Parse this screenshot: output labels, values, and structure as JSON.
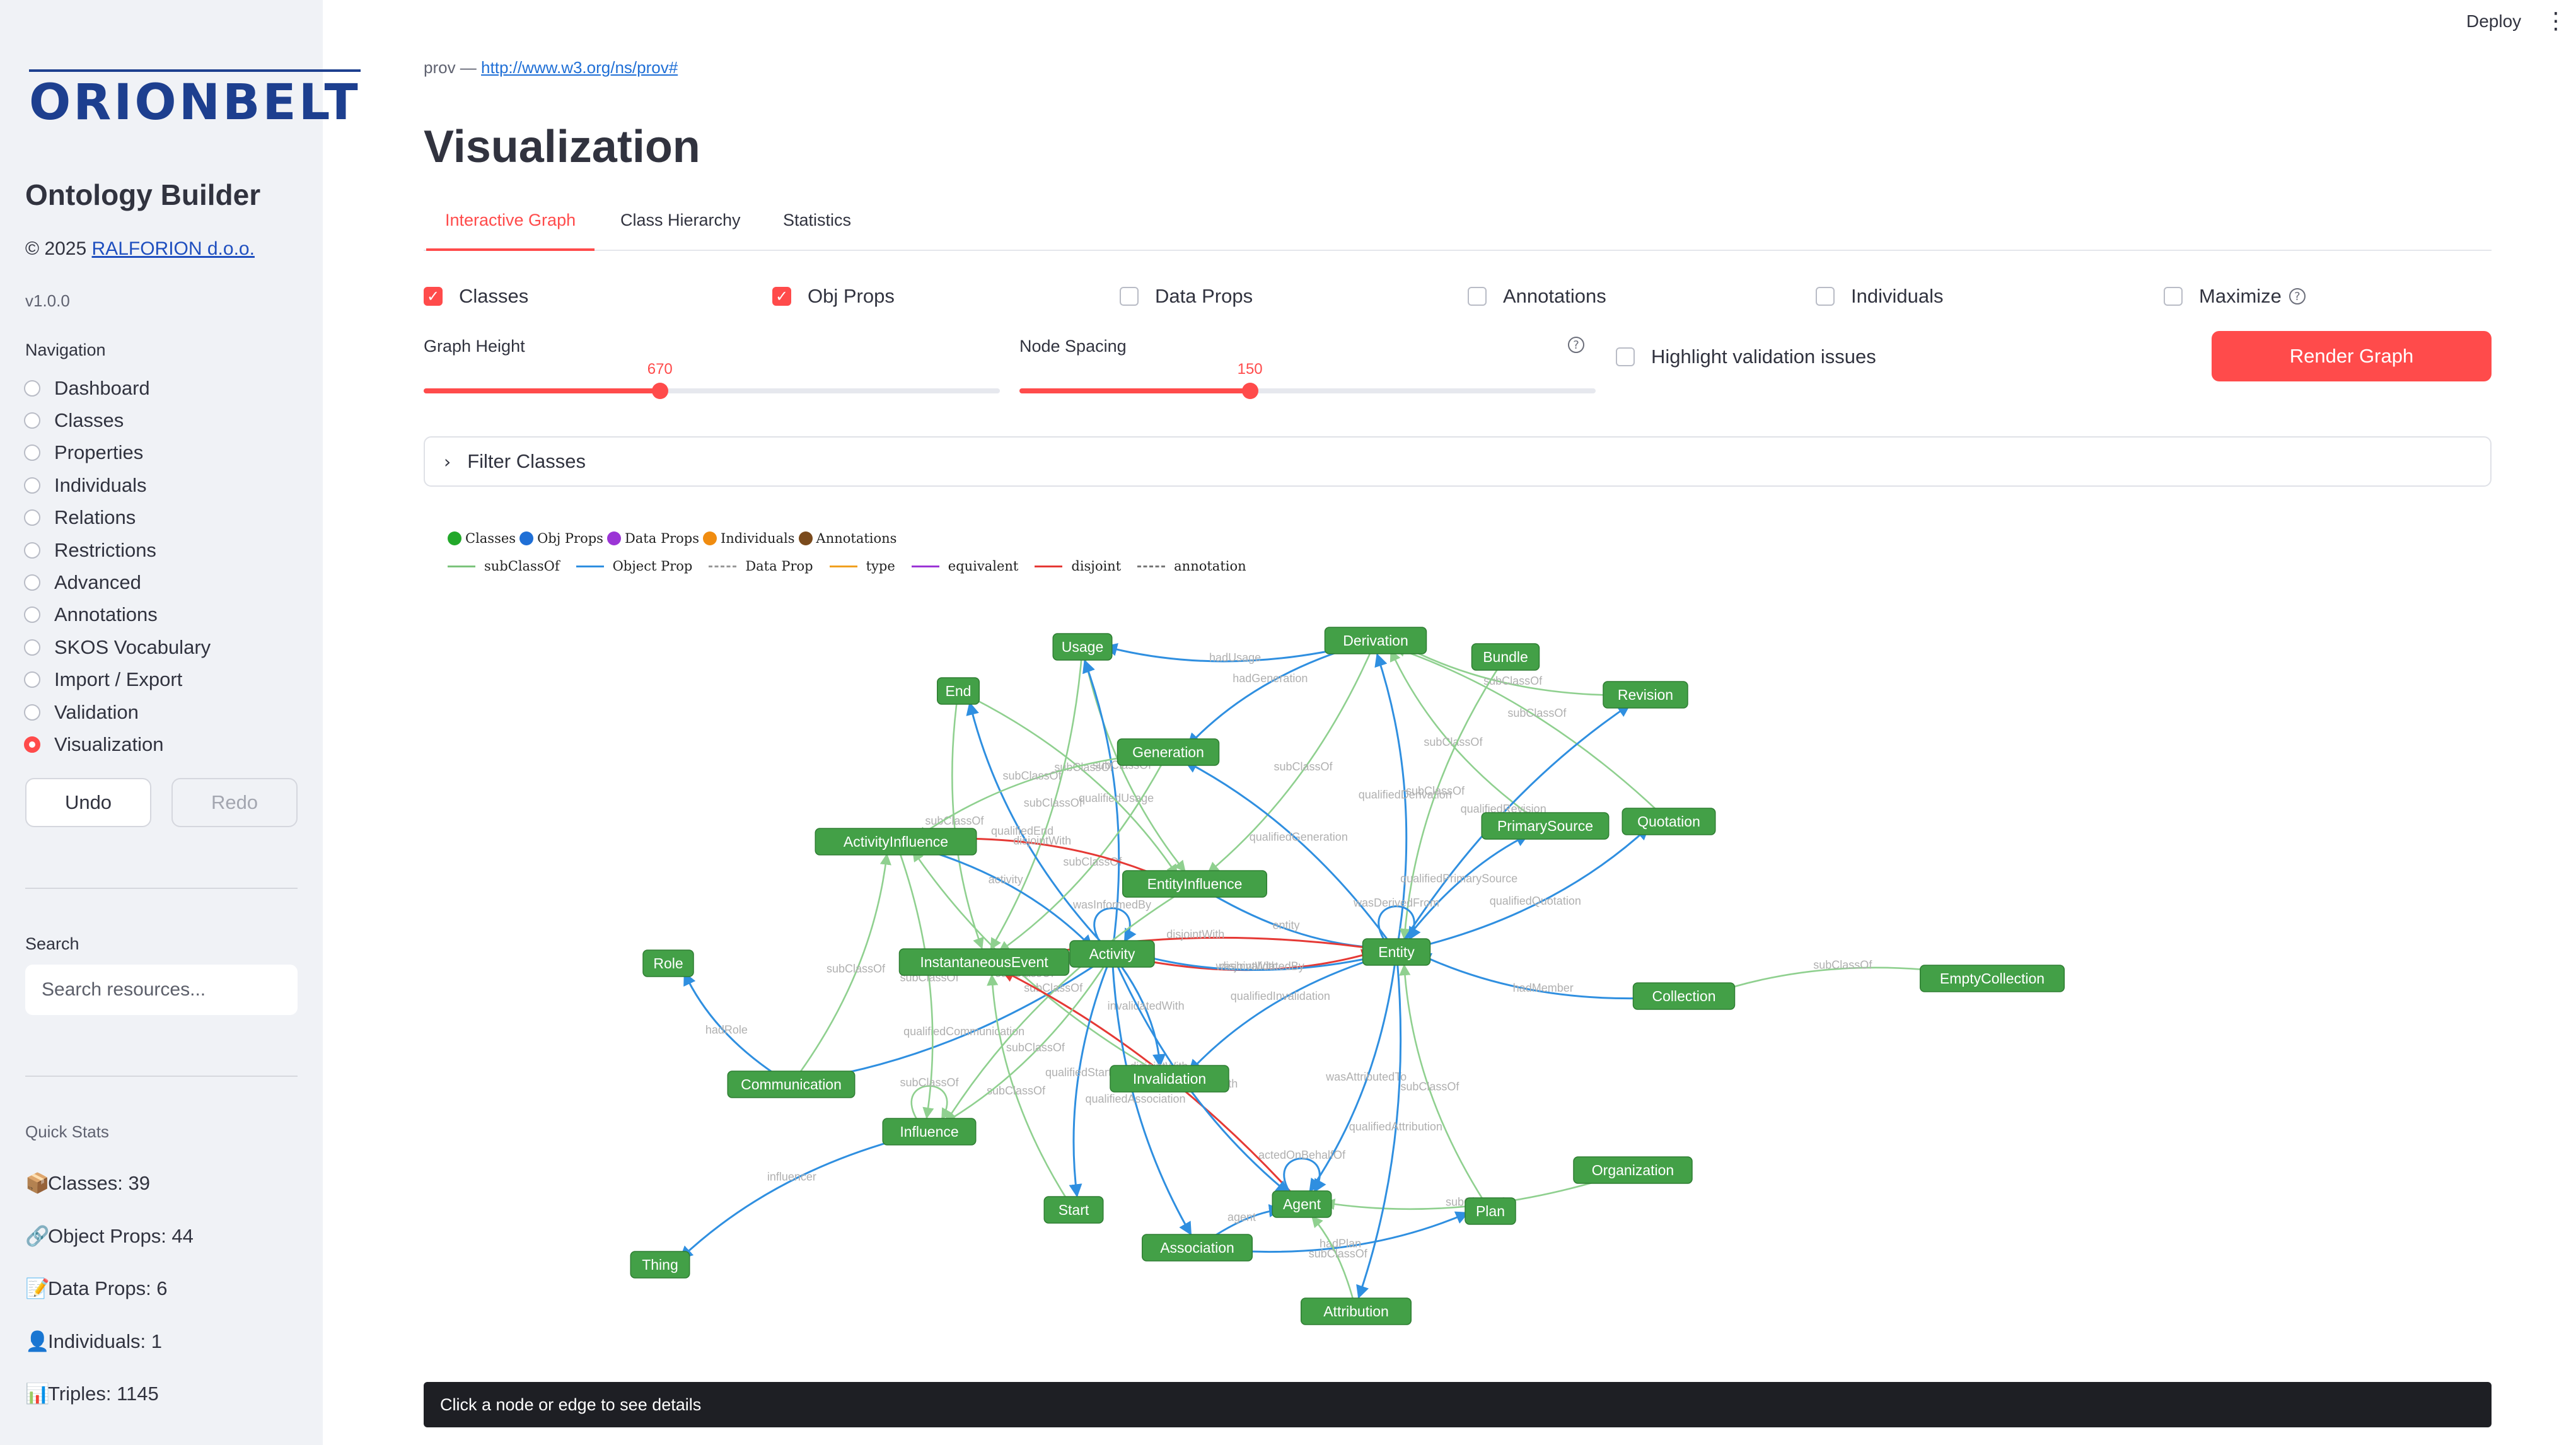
{
  "sidebar": {
    "logo": "ORIONBELT",
    "app_title": "Ontology Builder",
    "copyright_prefix": "© 2025 ",
    "copyright_link": "RALFORION d.o.o.",
    "version": "v1.0.0",
    "nav_label": "Navigation",
    "nav_items": [
      {
        "label": "Dashboard",
        "selected": false
      },
      {
        "label": "Classes",
        "selected": false
      },
      {
        "label": "Properties",
        "selected": false
      },
      {
        "label": "Individuals",
        "selected": false
      },
      {
        "label": "Relations",
        "selected": false
      },
      {
        "label": "Restrictions",
        "selected": false
      },
      {
        "label": "Advanced",
        "selected": false
      },
      {
        "label": "Annotations",
        "selected": false
      },
      {
        "label": "SKOS Vocabulary",
        "selected": false
      },
      {
        "label": "Import / Export",
        "selected": false
      },
      {
        "label": "Validation",
        "selected": false
      },
      {
        "label": "Visualization",
        "selected": true
      }
    ],
    "undo_label": "Undo",
    "redo_label": "Redo",
    "search_label": "Search",
    "search_placeholder": "Search resources...",
    "quick_stats_label": "Quick Stats",
    "quick_stats": [
      {
        "icon": "📦",
        "text": "Classes: 39"
      },
      {
        "icon": "🔗",
        "text": "Object Props: 44"
      },
      {
        "icon": "📝",
        "text": "Data Props: 6"
      },
      {
        "icon": "👤",
        "text": "Individuals: 1"
      },
      {
        "icon": "📊",
        "text": "Triples: 1145"
      }
    ]
  },
  "topbar": {
    "deploy_label": "Deploy",
    "menu_icon": "⋮"
  },
  "breadcrumb": {
    "prefix": "prov — ",
    "link": "http://www.w3.org/ns/prov#"
  },
  "page_title": "Visualization",
  "tabs": [
    {
      "label": "Interactive Graph",
      "active": true
    },
    {
      "label": "Class Hierarchy",
      "active": false
    },
    {
      "label": "Statistics",
      "active": false
    }
  ],
  "checkboxes": [
    {
      "label": "Classes",
      "checked": true
    },
    {
      "label": "Obj Props",
      "checked": true
    },
    {
      "label": "Data Props",
      "checked": false
    },
    {
      "label": "Annotations",
      "checked": false
    },
    {
      "label": "Individuals",
      "checked": false
    },
    {
      "label": "Maximize",
      "checked": false
    }
  ],
  "graph_height": {
    "label": "Graph Height",
    "value": "670",
    "fraction": 0.41
  },
  "node_spacing": {
    "label": "Node Spacing",
    "value": "150",
    "fraction": 0.4
  },
  "highlight_label": "Highlight validation issues",
  "render_label": "Render Graph",
  "filter_label": "Filter Classes",
  "legend": {
    "nodes": [
      {
        "label": "Classes",
        "color": "#22a82a"
      },
      {
        "label": "Obj Props",
        "color": "#1f6fd6"
      },
      {
        "label": "Data Props",
        "color": "#9b35d6"
      },
      {
        "label": "Individuals",
        "color": "#f08c10"
      },
      {
        "label": "Annotations",
        "color": "#7a4a1c"
      }
    ],
    "edges": [
      {
        "label": "subClassOf",
        "color": "#7cc47c",
        "dashed": false
      },
      {
        "label": "Object Prop",
        "color": "#2f8fe0",
        "dashed": false
      },
      {
        "label": "Data Prop",
        "color": "#999999",
        "dashed": true
      },
      {
        "label": "type",
        "color": "#f0a020",
        "dashed": false
      },
      {
        "label": "equivalent",
        "color": "#9b35d6",
        "dashed": false
      },
      {
        "label": "disjoint",
        "color": "#e53935",
        "dashed": false
      },
      {
        "label": "annotation",
        "color": "#777777",
        "dashed": true
      }
    ]
  },
  "graph": {
    "node_color": "#43a047",
    "nodes": [
      {
        "id": "Usage",
        "label": "Usage"
      },
      {
        "id": "Derivation",
        "label": "Derivation"
      },
      {
        "id": "Bundle",
        "label": "Bundle"
      },
      {
        "id": "End",
        "label": "End"
      },
      {
        "id": "Revision",
        "label": "Revision"
      },
      {
        "id": "Generation",
        "label": "Generation"
      },
      {
        "id": "Quotation",
        "label": "Quotation"
      },
      {
        "id": "PrimarySource",
        "label": "PrimarySource"
      },
      {
        "id": "ActivityInfluence",
        "label": "ActivityInfluence"
      },
      {
        "id": "EntityInfluence",
        "label": "EntityInfluence"
      },
      {
        "id": "Role",
        "label": "Role"
      },
      {
        "id": "InstantaneousEvent",
        "label": "InstantaneousEvent"
      },
      {
        "id": "Activity",
        "label": "Activity"
      },
      {
        "id": "Entity",
        "label": "Entity"
      },
      {
        "id": "EmptyCollection",
        "label": "EmptyCollection"
      },
      {
        "id": "Collection",
        "label": "Collection"
      },
      {
        "id": "Communication",
        "label": "Communication"
      },
      {
        "id": "Invalidation",
        "label": "Invalidation"
      },
      {
        "id": "Influence",
        "label": "Influence"
      },
      {
        "id": "Organization",
        "label": "Organization"
      },
      {
        "id": "Start",
        "label": "Start"
      },
      {
        "id": "Agent",
        "label": "Agent"
      },
      {
        "id": "Plan",
        "label": "Plan"
      },
      {
        "id": "Thing",
        "label": "Thing"
      },
      {
        "id": "Association",
        "label": "Association"
      },
      {
        "id": "Attribution",
        "label": "Attribution"
      }
    ],
    "edges": [
      {
        "from": "Derivation",
        "to": "Usage",
        "label": "hadUsage",
        "kind": "obj"
      },
      {
        "from": "Derivation",
        "to": "Generation",
        "label": "hadGeneration",
        "kind": "obj"
      },
      {
        "from": "Derivation",
        "to": "EntityInfluence",
        "label": "subClassOf",
        "kind": "sub"
      },
      {
        "from": "Entity",
        "to": "Derivation",
        "label": "qualifiedDerivation",
        "kind": "obj"
      },
      {
        "from": "Revision",
        "to": "Derivation",
        "label": "subClassOf",
        "kind": "sub"
      },
      {
        "from": "Quotation",
        "to": "Derivation",
        "label": "subClassOf",
        "kind": "sub"
      },
      {
        "from": "PrimarySource",
        "to": "Derivation",
        "label": "subClassOf",
        "kind": "sub"
      },
      {
        "from": "Bundle",
        "to": "Entity",
        "label": "subClassOf",
        "kind": "sub"
      },
      {
        "from": "Entity",
        "to": "Revision",
        "label": "qualifiedRevision",
        "kind": "obj"
      },
      {
        "from": "Entity",
        "to": "Quotation",
        "label": "qualifiedQuotation",
        "kind": "obj"
      },
      {
        "from": "Entity",
        "to": "PrimarySource",
        "label": "qualifiedPrimarySource",
        "kind": "obj"
      },
      {
        "from": "Usage",
        "to": "EntityInfluence",
        "label": "subClassOf",
        "kind": "sub"
      },
      {
        "from": "Usage",
        "to": "InstantaneousEvent",
        "label": "subClassOf",
        "kind": "sub"
      },
      {
        "from": "Activity",
        "to": "Usage",
        "label": "qualifiedUsage",
        "kind": "obj"
      },
      {
        "from": "End",
        "to": "EntityInfluence",
        "label": "subClassOf",
        "kind": "sub"
      },
      {
        "from": "End",
        "to": "InstantaneousEvent",
        "label": "subClassOf",
        "kind": "sub"
      },
      {
        "from": "Activity",
        "to": "End",
        "label": "qualifiedEnd",
        "kind": "obj"
      },
      {
        "from": "Generation",
        "to": "ActivityInfluence",
        "label": "subClassOf",
        "kind": "sub"
      },
      {
        "from": "Generation",
        "to": "InstantaneousEvent",
        "label": "subClassOf",
        "kind": "sub"
      },
      {
        "from": "Entity",
        "to": "Generation",
        "label": "qualifiedGeneration",
        "kind": "obj"
      },
      {
        "from": "ActivityInfluence",
        "to": "EntityInfluence",
        "label": "disjointWith",
        "kind": "disjoint"
      },
      {
        "from": "EntityInfluence",
        "to": "Entity",
        "label": "entity",
        "kind": "obj"
      },
      {
        "from": "ActivityInfluence",
        "to": "Activity",
        "label": "activity",
        "kind": "obj"
      },
      {
        "from": "Activity",
        "to": "Entity",
        "label": "disjointWith",
        "kind": "disjoint"
      },
      {
        "from": "Activity",
        "to": "Activity",
        "label": "wasInformedBy",
        "kind": "obj"
      },
      {
        "from": "Entity",
        "to": "Entity",
        "label": "wasDerivedFrom",
        "kind": "obj"
      },
      {
        "from": "Entity",
        "to": "Activity",
        "label": "wasInvalidatedBy",
        "kind": "obj"
      },
      {
        "from": "Entity",
        "to": "InstantaneousEvent",
        "label": "disjointWith",
        "kind": "disjoint"
      },
      {
        "from": "Collection",
        "to": "Entity",
        "label": "hadMember",
        "kind": "obj"
      },
      {
        "from": "EmptyCollection",
        "to": "Collection",
        "label": "subClassOf",
        "kind": "sub"
      },
      {
        "from": "Communication",
        "to": "Role",
        "label": "hadRole",
        "kind": "obj"
      },
      {
        "from": "Communication",
        "to": "ActivityInfluence",
        "label": "subClassOf",
        "kind": "sub"
      },
      {
        "from": "Activity",
        "to": "Communication",
        "label": "qualifiedCommunication",
        "kind": "obj"
      },
      {
        "from": "Influence",
        "to": "Thing",
        "label": "influencer",
        "kind": "obj"
      },
      {
        "from": "ActivityInfluence",
        "to": "Influence",
        "label": "subClassOf",
        "kind": "sub"
      },
      {
        "from": "EntityInfluence",
        "to": "Influence",
        "label": "subClassOf",
        "kind": "sub"
      },
      {
        "from": "Invalidation",
        "to": "ActivityInfluence",
        "label": "subClassOf",
        "kind": "sub"
      },
      {
        "from": "Entity",
        "to": "Invalidation",
        "label": "qualifiedInvalidation",
        "kind": "obj"
      },
      {
        "from": "Activity",
        "to": "Invalidation",
        "label": "invalidatedWith",
        "kind": "obj"
      },
      {
        "from": "Agent",
        "to": "InstantaneousEvent",
        "label": "disjointWith",
        "kind": "disjoint"
      },
      {
        "from": "Start",
        "to": "InstantaneousEvent",
        "label": "subClassOf",
        "kind": "sub"
      },
      {
        "from": "Activity",
        "to": "Start",
        "label": "qualifiedStart",
        "kind": "obj"
      },
      {
        "from": "Entity",
        "to": "Agent",
        "label": "wasAttributedTo",
        "kind": "obj"
      },
      {
        "from": "Agent",
        "to": "Agent",
        "label": "actedOnBehalfOf",
        "kind": "obj"
      },
      {
        "from": "Plan",
        "to": "Entity",
        "label": "subClassOf",
        "kind": "sub"
      },
      {
        "from": "Association",
        "to": "Plan",
        "label": "hadPlan",
        "kind": "obj"
      },
      {
        "from": "Organization",
        "to": "Agent",
        "label": "subClassOf",
        "kind": "sub"
      },
      {
        "from": "Activity",
        "to": "Association",
        "label": "qualifiedAssociation",
        "kind": "obj"
      },
      {
        "from": "Association",
        "to": "Agent",
        "label": "agent",
        "kind": "obj"
      },
      {
        "from": "Attribution",
        "to": "Agent",
        "label": "subClassOf",
        "kind": "sub"
      },
      {
        "from": "Entity",
        "to": "Attribution",
        "label": "qualifiedAttribution",
        "kind": "obj"
      },
      {
        "from": "Influence",
        "to": "Influence",
        "label": "subClassOf",
        "kind": "sub"
      },
      {
        "from": "Activity",
        "to": "Influence",
        "label": "subClassOf",
        "kind": "sub"
      },
      {
        "from": "Activity",
        "to": "Agent",
        "label": "wasAssociatedWith",
        "kind": "obj"
      }
    ]
  },
  "details_text": "Click a node or edge to see details"
}
